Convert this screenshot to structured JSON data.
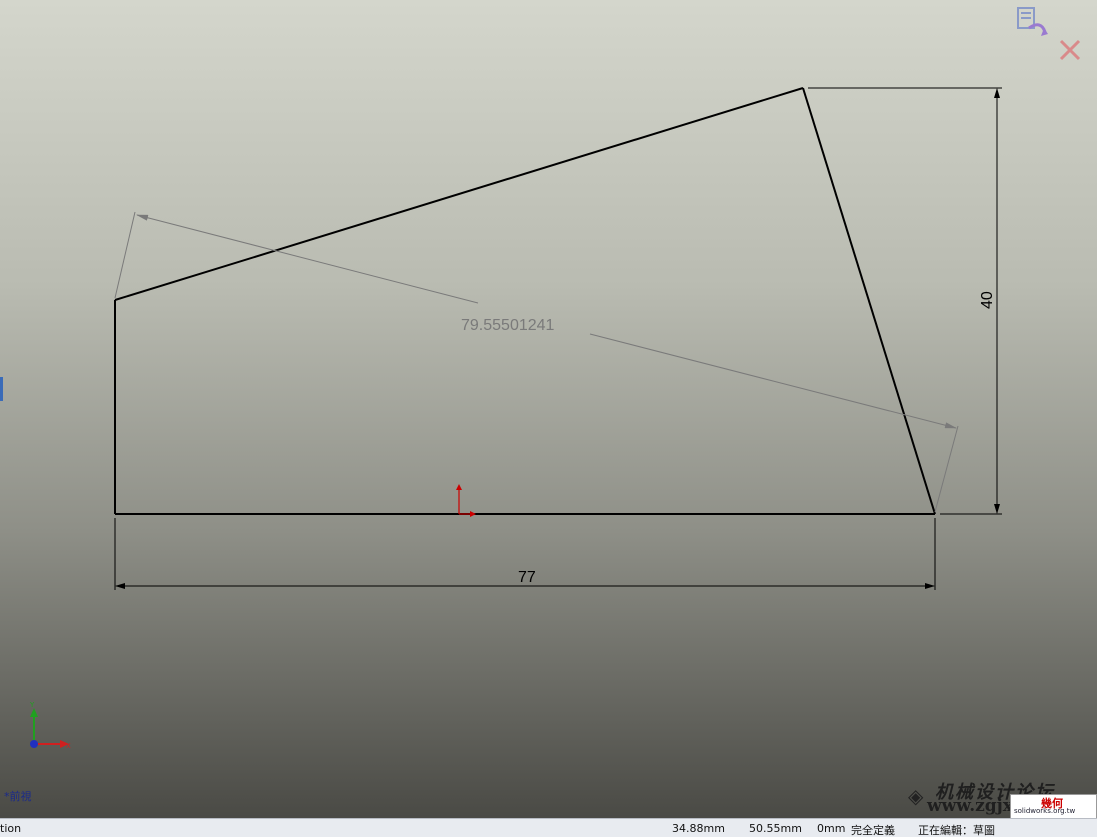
{
  "sketch": {
    "dimensions": {
      "horizontal": "77",
      "vertical": "40",
      "diagonal": "79.55501241"
    }
  },
  "viewport": {
    "view_name": "*前視"
  },
  "confirm_corner": {
    "confirm_icon": "sketch-exit-icon",
    "close_icon": "close-icon"
  },
  "statusbar": {
    "left_text": "tion",
    "x": "34.88mm",
    "y": "50.55mm",
    "z": "0mm",
    "state": "完全定義",
    "editing": "正在編輯：草圖"
  },
  "watermark": {
    "title": "机械设计论坛",
    "url": "www.zgjxcad.com",
    "badge": "幾何",
    "badge_sub": "solidworks.org.tw"
  },
  "colors": {
    "sketch_line": "#000000",
    "driven_dim": "#7a7a7a",
    "origin_x": "#cc0000",
    "origin_y": "#cc0000",
    "triad_x": "#d02020",
    "triad_y": "#20a020",
    "triad_origin": "#2030c0"
  }
}
